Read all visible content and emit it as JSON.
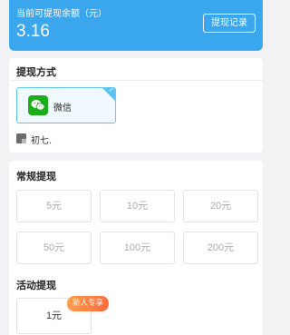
{
  "balance": {
    "label": "当前可提现余额（元）",
    "amount": "3.16",
    "history_button": "提现记录"
  },
  "method": {
    "title": "提现方式",
    "option_label": "微信",
    "option_icon": "wechat-icon",
    "selected": true,
    "user_name": "初七."
  },
  "regular": {
    "title": "常规提现",
    "amounts": [
      "5元",
      "10元",
      "20元",
      "50元",
      "100元",
      "200元"
    ]
  },
  "activity": {
    "title": "活动提现",
    "amount": "1元",
    "badge": "新人专享"
  },
  "colors": {
    "accent": "#3aa6ee",
    "wechat": "#1aad19",
    "badge": "#ff7a3d"
  }
}
